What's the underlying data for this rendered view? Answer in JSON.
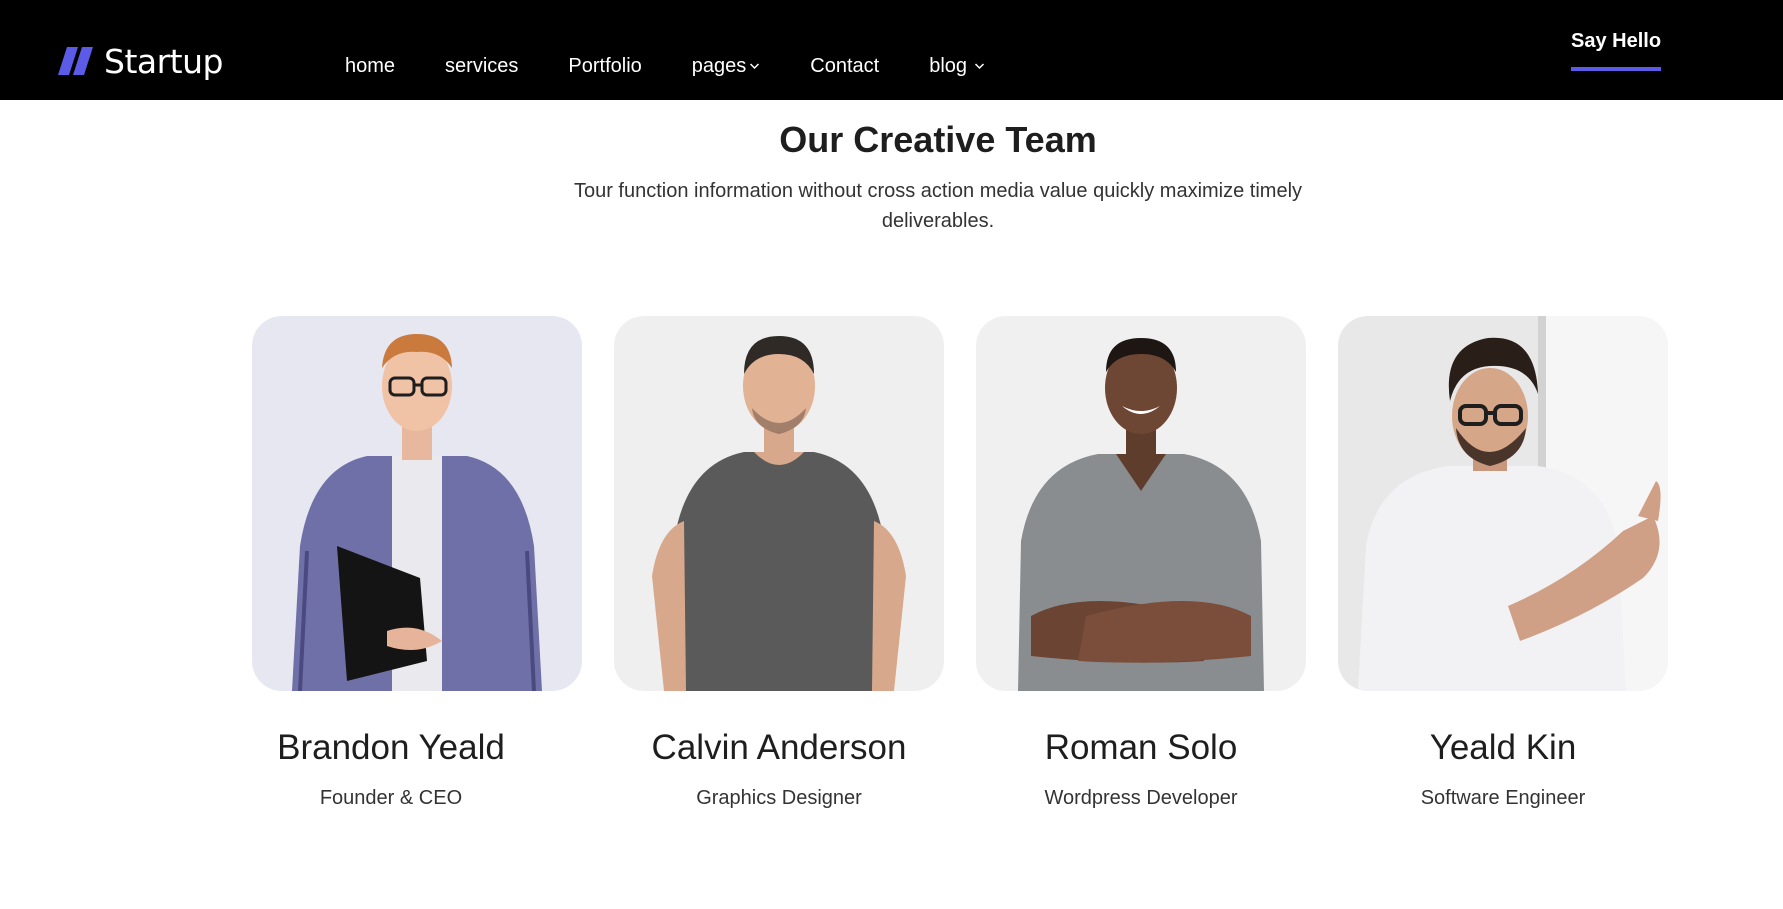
{
  "brand": {
    "name": "Startup",
    "accent": "#5b5be8"
  },
  "nav": {
    "items": [
      {
        "label": "home",
        "dropdown": false
      },
      {
        "label": "services",
        "dropdown": false
      },
      {
        "label": "Portfolio",
        "dropdown": false
      },
      {
        "label": "pages",
        "dropdown": true
      },
      {
        "label": "Contact",
        "dropdown": false
      },
      {
        "label": "blog",
        "dropdown": true
      }
    ],
    "cta_label": "Say Hello"
  },
  "section": {
    "title": "Our Creative Team",
    "subtitle": "Tour function information without cross action media value quickly maximize timely deliverables."
  },
  "team": [
    {
      "name": "Brandon Yeald",
      "role": "Founder & CEO"
    },
    {
      "name": "Calvin Anderson",
      "role": "Graphics Designer"
    },
    {
      "name": "Roman Solo",
      "role": "Wordpress Developer"
    },
    {
      "name": "Yeald Kin",
      "role": "Software Engineer"
    }
  ]
}
